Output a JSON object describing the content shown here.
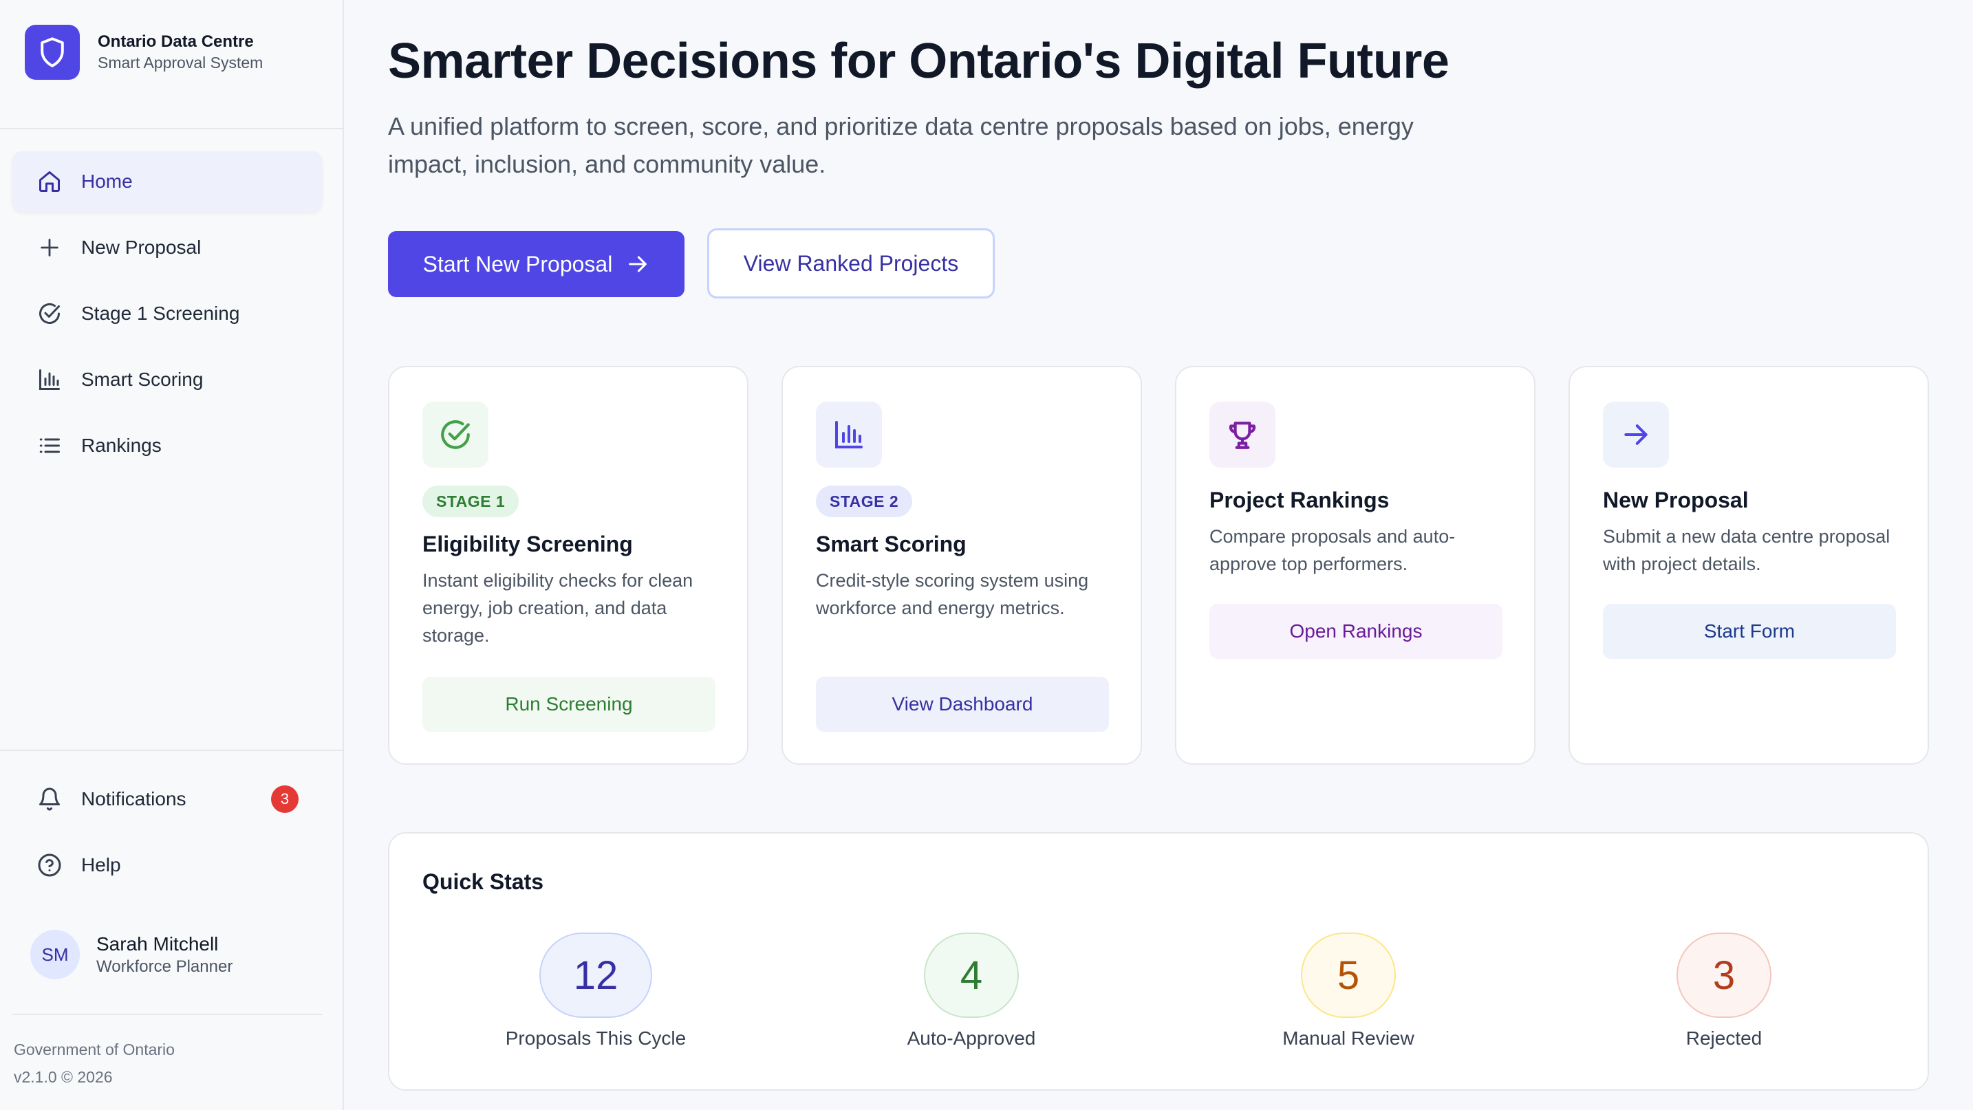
{
  "brand": {
    "title": "Ontario Data Centre",
    "subtitle": "Smart Approval System"
  },
  "nav": {
    "items": [
      {
        "label": "Home",
        "icon": "home-icon",
        "active": true
      },
      {
        "label": "New Proposal",
        "icon": "plus-icon"
      },
      {
        "label": "Stage 1 Screening",
        "icon": "check-circle-icon"
      },
      {
        "label": "Smart Scoring",
        "icon": "bar-chart-icon"
      },
      {
        "label": "Rankings",
        "icon": "list-icon"
      }
    ],
    "bottom": [
      {
        "label": "Notifications",
        "icon": "bell-icon",
        "badge": "3"
      },
      {
        "label": "Help",
        "icon": "help-circle-icon"
      }
    ]
  },
  "user": {
    "initials": "SM",
    "name": "Sarah Mitchell",
    "role": "Workforce Planner"
  },
  "footer": {
    "org": "Government of Ontario",
    "version": "v2.1.0 © 2026"
  },
  "hero": {
    "title": "Smarter Decisions for Ontario's Digital Future",
    "subtitle": "A unified platform to screen, score, and prioritize data centre proposals based on jobs, energy impact, inclusion, and community value.",
    "primary_button": "Start New Proposal",
    "secondary_button": "View Ranked Projects"
  },
  "cards": [
    {
      "icon": "check-circle-icon",
      "stage": "STAGE 1",
      "title": "Eligibility Screening",
      "description": "Instant eligibility checks for clean energy, job creation, and data storage.",
      "button": "Run Screening"
    },
    {
      "icon": "bar-chart-icon",
      "stage": "STAGE 2",
      "title": "Smart Scoring",
      "description": "Credit-style scoring system using workforce and energy metrics.",
      "button": "View Dashboard"
    },
    {
      "icon": "trophy-icon",
      "title": "Project Rankings",
      "description": "Compare proposals and auto-approve top performers.",
      "button": "Open Rankings"
    },
    {
      "icon": "arrow-right-icon",
      "title": "New Proposal",
      "description": "Submit a new data centre proposal with project details.",
      "button": "Start Form"
    }
  ],
  "stats": {
    "title": "Quick Stats",
    "items": [
      {
        "value": "12",
        "label": "Proposals This Cycle",
        "color": "#3730a3"
      },
      {
        "value": "4",
        "label": "Auto-Approved",
        "color": "#2e7d32"
      },
      {
        "value": "5",
        "label": "Manual Review",
        "color": "#b45309"
      },
      {
        "value": "3",
        "label": "Rejected",
        "color": "#b23c1c"
      }
    ]
  },
  "colors": {
    "accent": "#4f46e5",
    "badge": "#e53935"
  }
}
